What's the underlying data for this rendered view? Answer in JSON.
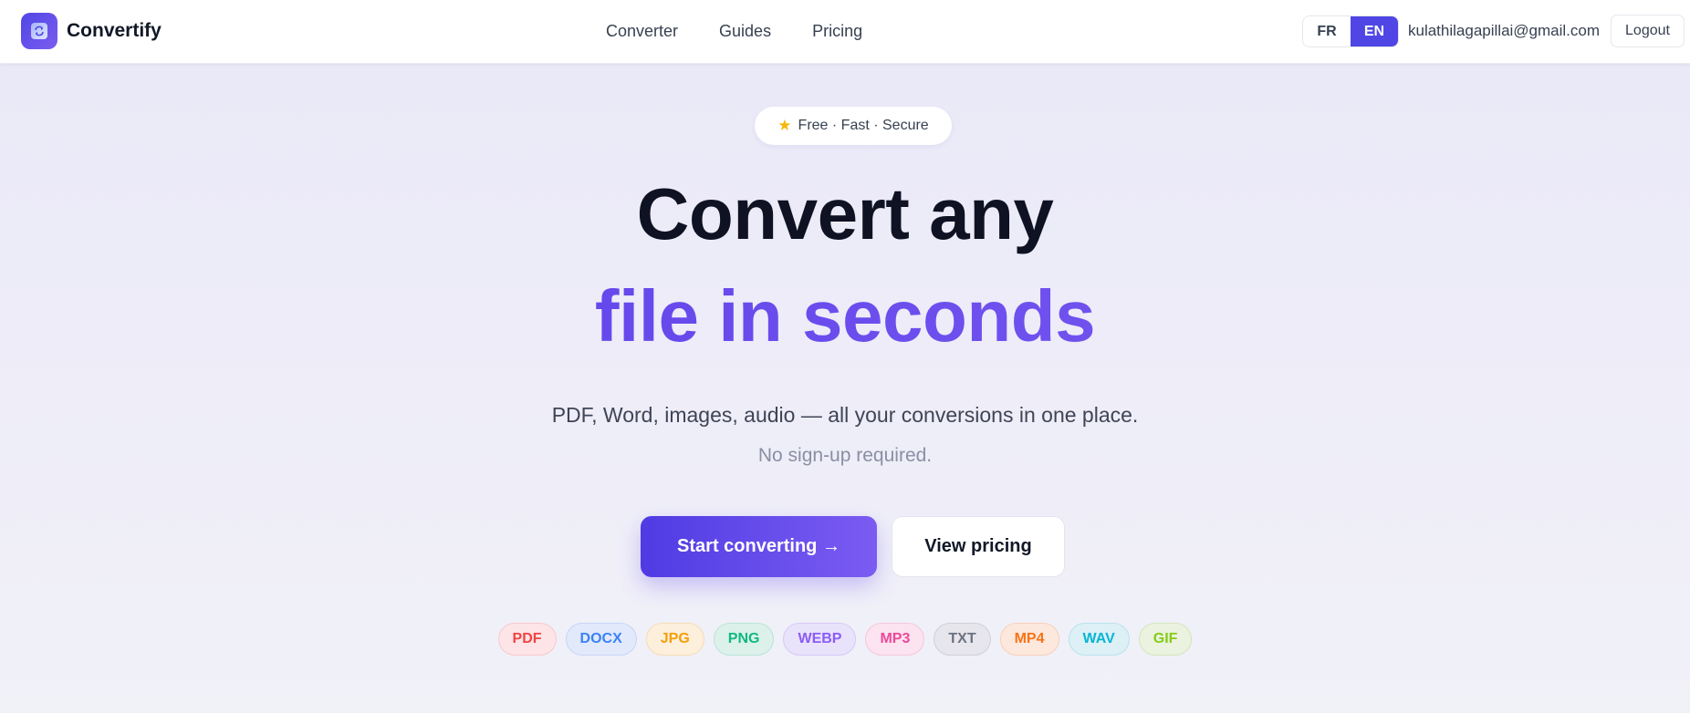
{
  "header": {
    "brand_name": "Convertify",
    "nav": [
      "Converter",
      "Guides",
      "Pricing"
    ],
    "lang": {
      "fr": "FR",
      "en": "EN",
      "active": "EN"
    },
    "email": "kulathilagapillai@gmail.com",
    "logout": "Logout"
  },
  "hero": {
    "badge_icon": "star-icon",
    "badge_text": "Free · Fast · Secure",
    "title_line1": "Convert any",
    "title_line2": "file in seconds",
    "subtitle": "PDF, Word, images, audio — all your conversions in one place.",
    "subnote": "No sign-up required.",
    "primary_button": "Start converting →",
    "secondary_button": "View pricing"
  },
  "colors": {
    "accent": "#4f46e5",
    "accent_light": "#7b5cf2"
  },
  "formats": [
    {
      "label": "PDF",
      "color": "#ef4444",
      "bg": "#fde4e6",
      "border": "#f8c9cd"
    },
    {
      "label": "DOCX",
      "color": "#3b82f6",
      "bg": "#e1e9fb",
      "border": "#c7d6f6"
    },
    {
      "label": "JPG",
      "color": "#f59e0b",
      "bg": "#fcefdc",
      "border": "#f6dcb4"
    },
    {
      "label": "PNG",
      "color": "#10b981",
      "bg": "#dcf1ea",
      "border": "#b9e4d4"
    },
    {
      "label": "WEBP",
      "color": "#8b5cf6",
      "bg": "#e9e2fb",
      "border": "#d6c9f7"
    },
    {
      "label": "MP3",
      "color": "#ec4899",
      "bg": "#fbe3ef",
      "border": "#f5c7de"
    },
    {
      "label": "TXT",
      "color": "#6b7280",
      "bg": "#e6e6ec",
      "border": "#cfd0d8"
    },
    {
      "label": "MP4",
      "color": "#f97316",
      "bg": "#fde8dd",
      "border": "#f8cfb9"
    },
    {
      "label": "WAV",
      "color": "#06b6d4",
      "bg": "#dcf0f6",
      "border": "#b8e2ec"
    },
    {
      "label": "GIF",
      "color": "#84cc16",
      "bg": "#ebf2df",
      "border": "#d4e5bb"
    }
  ]
}
